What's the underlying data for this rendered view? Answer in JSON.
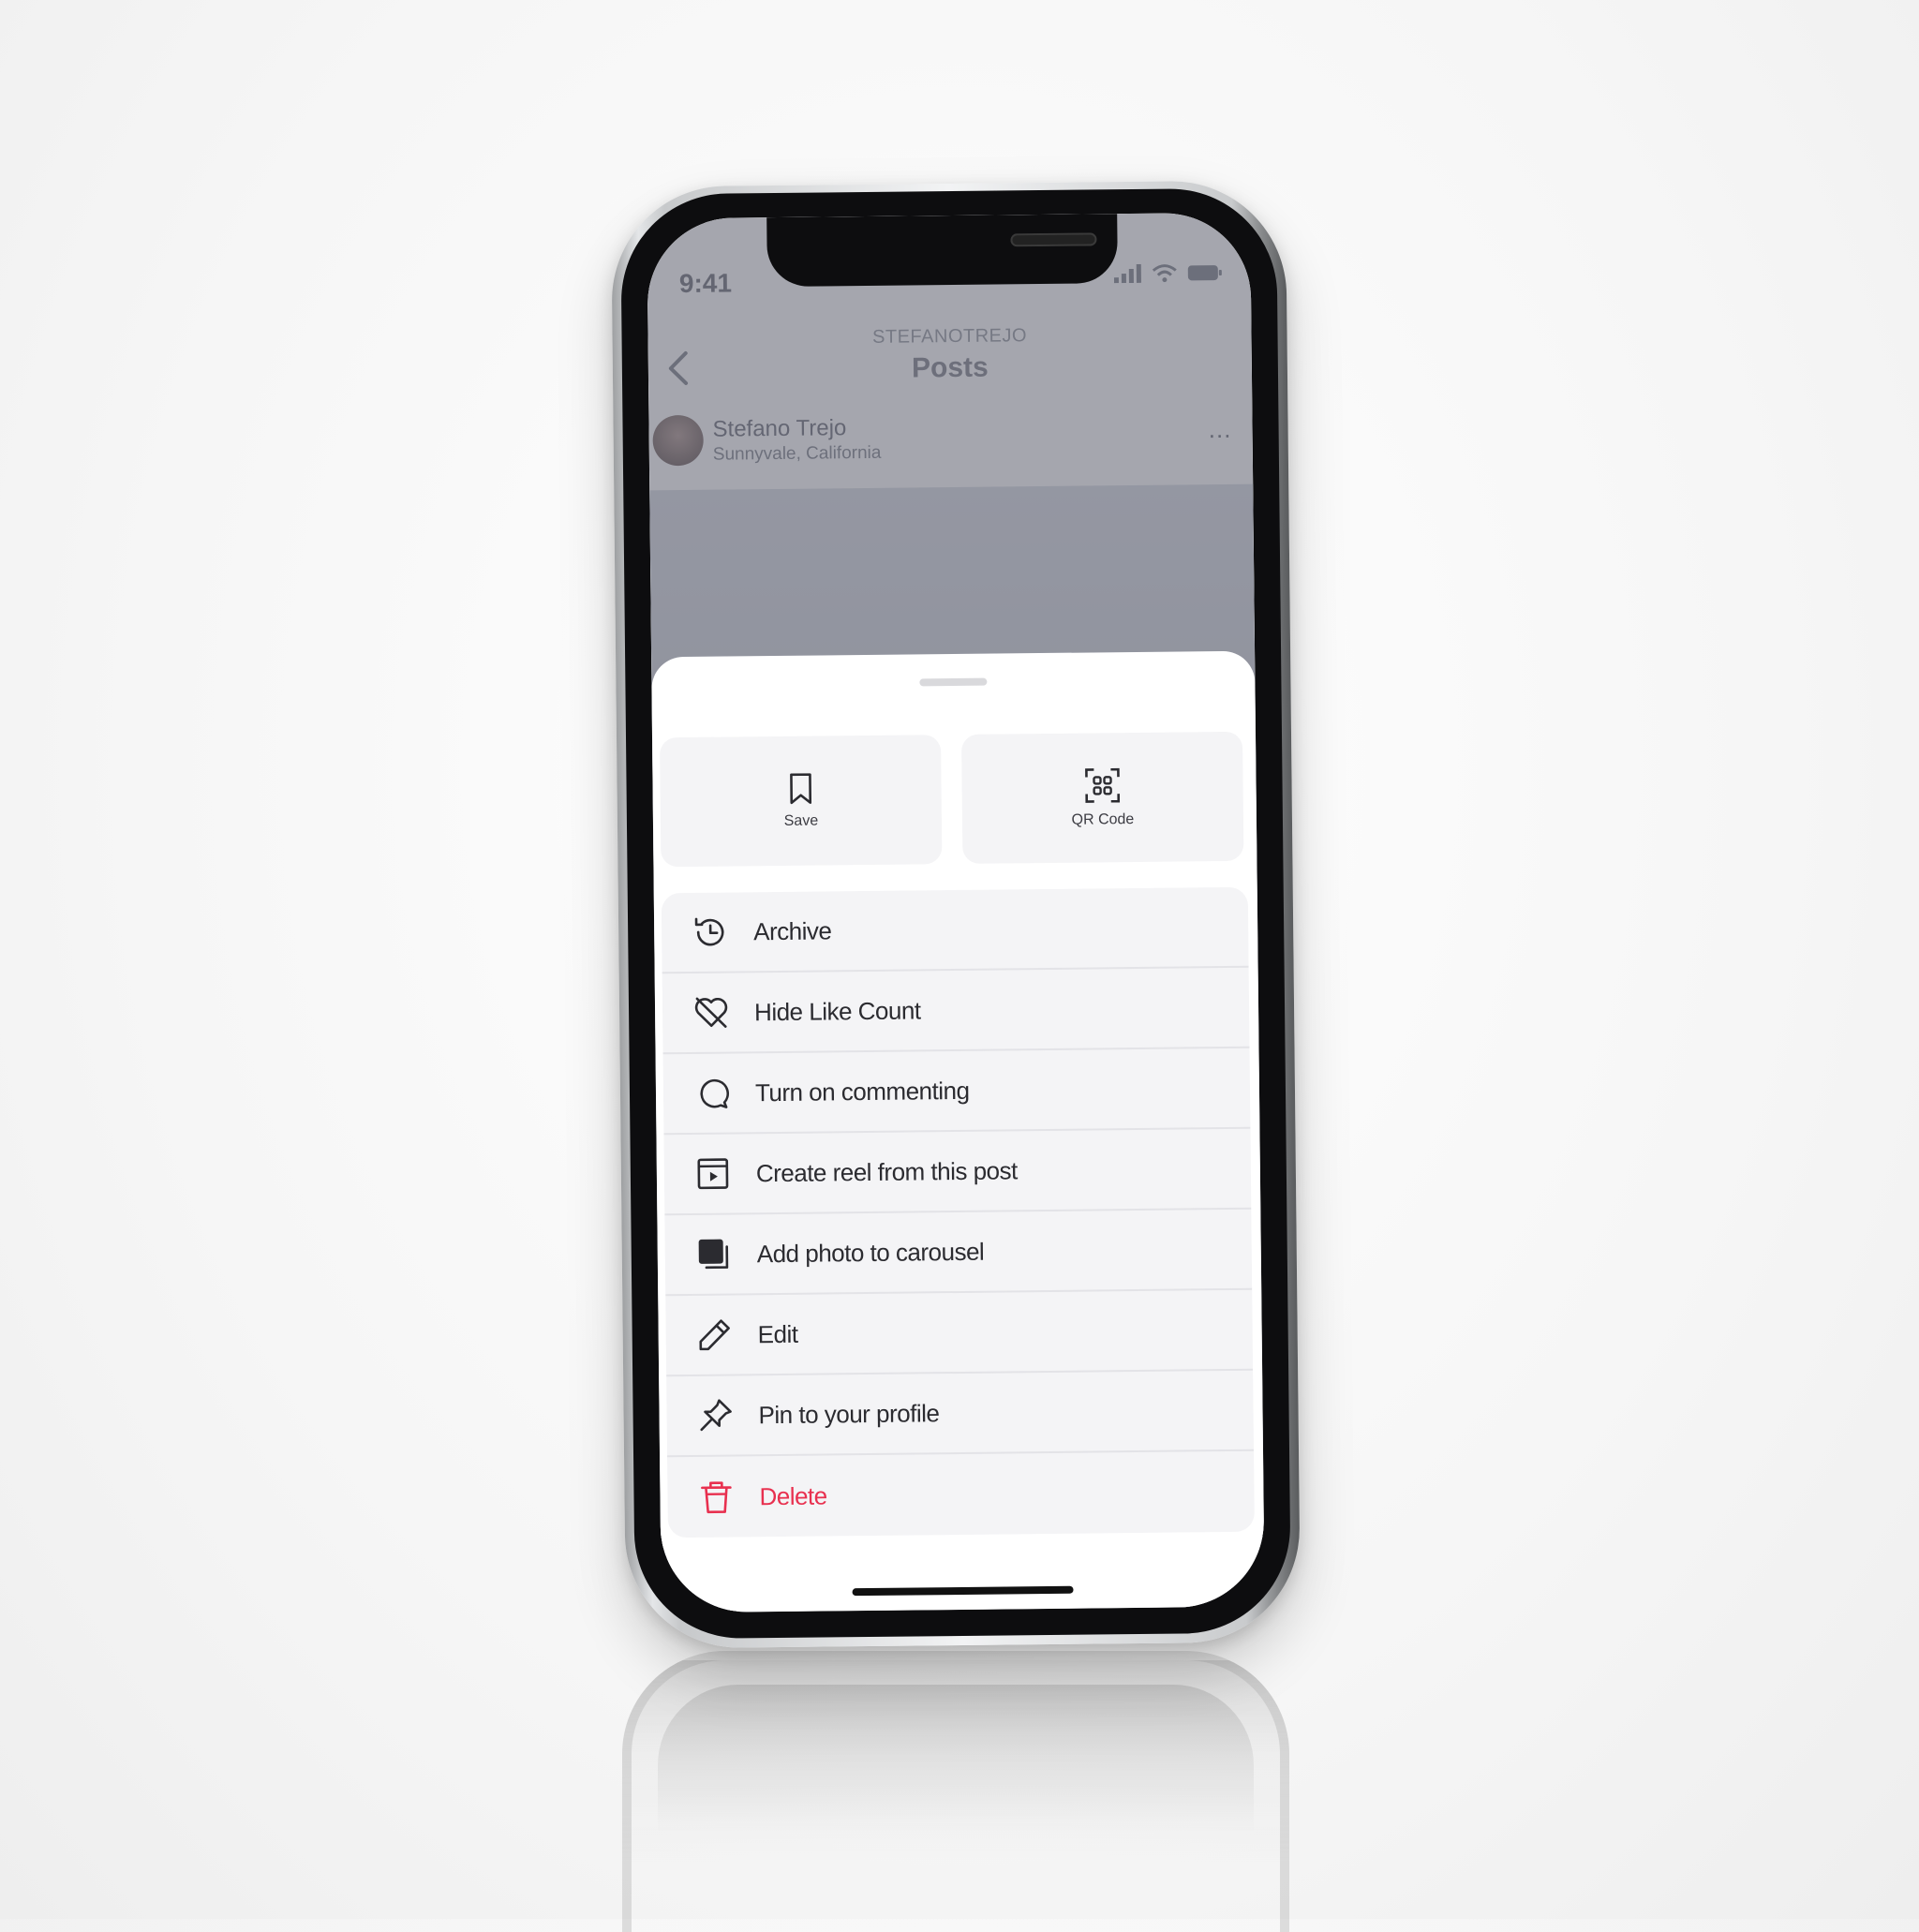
{
  "status_bar": {
    "time": "9:41"
  },
  "nav": {
    "subtitle": "STEFANOTREJO",
    "title": "Posts"
  },
  "post": {
    "author": "Stefano Trejo",
    "location": "Sunnyvale, California",
    "more": "…"
  },
  "sheet": {
    "tiles": [
      {
        "label": "Save",
        "icon": "bookmark-icon"
      },
      {
        "label": "QR Code",
        "icon": "qr-scan-icon"
      }
    ],
    "menu": [
      {
        "label": "Archive",
        "icon": "archive-history-icon"
      },
      {
        "label": "Hide Like Count",
        "icon": "heart-off-icon"
      },
      {
        "label": "Turn on commenting",
        "icon": "comment-bubble-icon"
      },
      {
        "label": "Create reel from this post",
        "icon": "reel-icon"
      },
      {
        "label": "Add photo to carousel",
        "icon": "carousel-icon"
      },
      {
        "label": "Edit",
        "icon": "pencil-icon"
      },
      {
        "label": "Pin to your profile",
        "icon": "pin-icon"
      },
      {
        "label": "Delete",
        "icon": "trash-icon",
        "color": "#e8304f"
      }
    ]
  },
  "colors": {
    "danger": "#e8304f",
    "sheet_bg": "#ffffff",
    "item_bg": "#f4f4f6"
  }
}
